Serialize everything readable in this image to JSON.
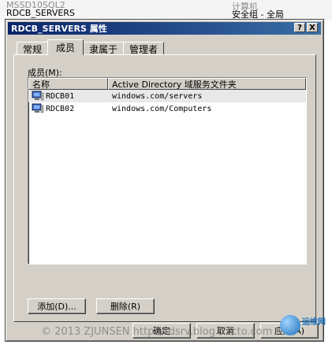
{
  "background_rows": [
    {
      "name": "MSSD10SQL2",
      "type": "计算机"
    },
    {
      "name": "RDCB_SERVERS",
      "type": "安全组 - 全局"
    }
  ],
  "dialog": {
    "title": "RDCB_SERVERS 属性",
    "help_button": "?",
    "close_button": "X"
  },
  "tabs": [
    {
      "label": "常规",
      "active": false
    },
    {
      "label": "成员",
      "active": true
    },
    {
      "label": "隶属于",
      "active": false
    },
    {
      "label": "管理者",
      "active": false
    }
  ],
  "members": {
    "label": "成员(M):",
    "columns": [
      "名称",
      "Active Directory 域服务文件夹"
    ],
    "rows": [
      {
        "name": "RDCB01",
        "folder": "windows.com/servers",
        "selected": true
      },
      {
        "name": "RDCB02",
        "folder": "windows.com/Computers",
        "selected": false
      }
    ]
  },
  "buttons": {
    "add": "添加(D)...",
    "remove": "删除(R)",
    "ok": "确定",
    "cancel": "取消",
    "apply": "应用(A)"
  },
  "watermark": "© 2013 ZJUNSEN http://rdsrv.blog.51cto.com",
  "logo_text": "运维网",
  "icons": {
    "member": "computer-icon"
  }
}
